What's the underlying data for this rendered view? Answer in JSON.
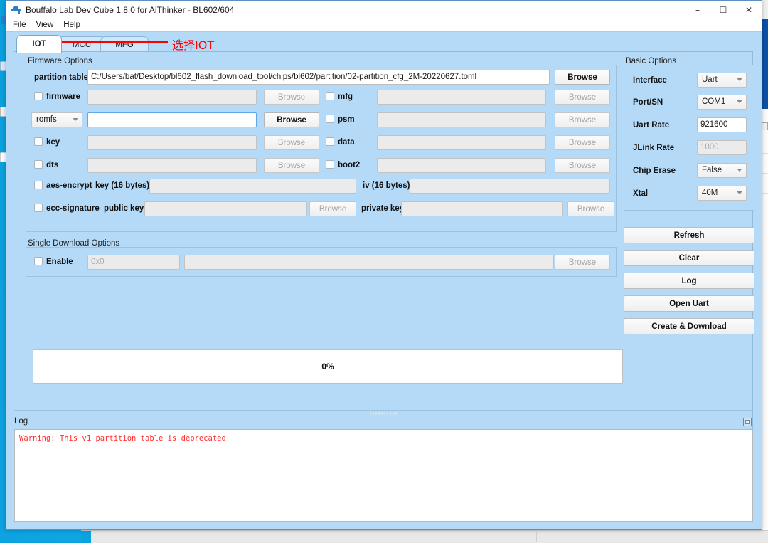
{
  "window": {
    "title": "Bouffalo Lab Dev Cube 1.8.0 for AiThinker - BL602/604",
    "icon": "graduation-cap-icon",
    "minimize": "–",
    "maximize": "☐",
    "close": "✕"
  },
  "menubar": {
    "items": [
      {
        "label": "File",
        "mnemonic": "F"
      },
      {
        "label": "View",
        "mnemonic": "V"
      },
      {
        "label": "Help",
        "mnemonic": "H"
      }
    ]
  },
  "tabs": [
    {
      "label": "IOT",
      "active": true
    },
    {
      "label": "MCU",
      "active": false
    },
    {
      "label": "MFG",
      "active": false
    }
  ],
  "firmware_options": {
    "title": "Firmware Options",
    "partition_table": {
      "label": "partition table",
      "value": "C:/Users/bat/Desktop/bl602_flash_download_tool/chips/bl602/partition/02-partition_cfg_2M-20220627.toml",
      "browse_label": "Browse",
      "browse_enabled": true
    },
    "rows": [
      {
        "left": {
          "type": "checkbox",
          "label": "firmware",
          "checked": false,
          "value": "",
          "enabled": false,
          "browse_label": "Browse",
          "browse_enabled": false
        },
        "right": {
          "type": "checkbox",
          "label": "mfg",
          "checked": false,
          "value": "",
          "enabled": false,
          "browse_label": "Browse",
          "browse_enabled": false
        }
      },
      {
        "left": {
          "type": "combo",
          "label": "romfs",
          "checked": false,
          "value": "",
          "enabled": true,
          "browse_label": "Browse",
          "browse_enabled": true
        },
        "right": {
          "type": "checkbox",
          "label": "psm",
          "checked": false,
          "value": "",
          "enabled": false,
          "browse_label": "Browse",
          "browse_enabled": false
        }
      },
      {
        "left": {
          "type": "checkbox",
          "label": "key",
          "checked": false,
          "value": "",
          "enabled": false,
          "browse_label": "Browse",
          "browse_enabled": false
        },
        "right": {
          "type": "checkbox",
          "label": "data",
          "checked": false,
          "value": "",
          "enabled": false,
          "browse_label": "Browse",
          "browse_enabled": false
        }
      },
      {
        "left": {
          "type": "checkbox",
          "label": "dts",
          "checked": false,
          "value": "",
          "enabled": false,
          "browse_label": "Browse",
          "browse_enabled": false
        },
        "right": {
          "type": "checkbox",
          "label": "boot2",
          "checked": false,
          "value": "",
          "enabled": false,
          "browse_label": "Browse",
          "browse_enabled": false
        }
      }
    ],
    "aes_encrypt": {
      "label": "aes-encrypt",
      "checked": false,
      "key_label": "key (16 bytes)",
      "key_value": "",
      "iv_label": "iv (16 bytes)",
      "iv_value": ""
    },
    "ecc_signature": {
      "label": "ecc-signature",
      "checked": false,
      "public_key_label": "public key",
      "public_key_value": "",
      "public_browse_label": "Browse",
      "private_key_label": "private key",
      "private_key_value": "",
      "private_browse_label": "Browse"
    }
  },
  "single_download_options": {
    "title": "Single Download Options",
    "enable_label": "Enable",
    "enable_checked": false,
    "address_placeholder": "0x0",
    "address_value": "",
    "file_value": "",
    "browse_label": "Browse"
  },
  "progress": {
    "percent_label": "0%",
    "value": 0
  },
  "basic_options": {
    "title": "Basic Options",
    "fields": [
      {
        "label": "Interface",
        "value": "Uart",
        "type": "combo",
        "enabled": true
      },
      {
        "label": "Port/SN",
        "value": "COM1",
        "type": "combo",
        "enabled": true
      },
      {
        "label": "Uart Rate",
        "value": "921600",
        "type": "text",
        "enabled": true
      },
      {
        "label": "JLink Rate",
        "value": "1000",
        "type": "text",
        "enabled": false
      },
      {
        "label": "Chip Erase",
        "value": "False",
        "type": "combo",
        "enabled": true
      },
      {
        "label": "Xtal",
        "value": "40M",
        "type": "combo",
        "enabled": true
      }
    ],
    "buttons": [
      {
        "label": "Refresh"
      },
      {
        "label": "Clear"
      },
      {
        "label": "Log"
      },
      {
        "label": "Open Uart"
      },
      {
        "label": "Create & Download"
      }
    ]
  },
  "log": {
    "title": "Log",
    "float_icon": "float-window-icon",
    "lines": [
      "Warning: This v1 partition table is deprecated"
    ],
    "text_color": "#ff2d2d"
  },
  "annotation": {
    "text": "选择IOT",
    "color": "#ff0000",
    "arrow": "left-arrow"
  },
  "colors": {
    "client_background": "#b5daf8",
    "titlebar": "#ffffff",
    "desktop": "#0aa3e0",
    "group_border": "#9cc2de"
  }
}
